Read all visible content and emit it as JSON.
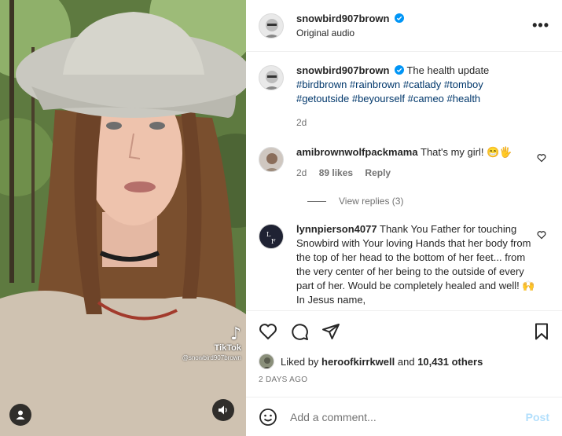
{
  "media": {
    "watermark_brand": "TikTok",
    "watermark_handle": "@snowbird907brown",
    "user_tag_icon": "person-icon",
    "audio_icon": "speaker-icon"
  },
  "header": {
    "username": "snowbird907brown",
    "audio": "Original audio",
    "more": "•••"
  },
  "caption": {
    "username": "snowbird907brown",
    "text": "The health update",
    "hashtags": "#birdbrown #rainbrown #catlady #tomboy #getoutside #beyourself #cameo #health",
    "time": "2d"
  },
  "comments": [
    {
      "username": "amibrownwolfpackmama",
      "text": "That's my girl! 😁🖐️",
      "time": "2d",
      "likes": "89 likes",
      "reply": "Reply"
    },
    {
      "username": "lynnpierson4077",
      "text": "Thank You Father for touching Snowbird with Your loving Hands that her body from the top of her head to the bottom of her feet... from the very center of her being to the outside of every part of her. Would be completely healed and well! 🙌 In Jesus name,"
    }
  ],
  "view_replies": "View replies (3)",
  "likes": {
    "prefix": "Liked by",
    "user": "heroofkirrkwell",
    "and": "and",
    "others": "10,431 others"
  },
  "date": "2 DAYS AGO",
  "composer": {
    "placeholder": "Add a comment...",
    "post": "Post"
  },
  "colors": {
    "verified": "#0095f6",
    "hashtag": "#00376b",
    "post_disabled": "#b2dffc",
    "muted": "#737373"
  }
}
